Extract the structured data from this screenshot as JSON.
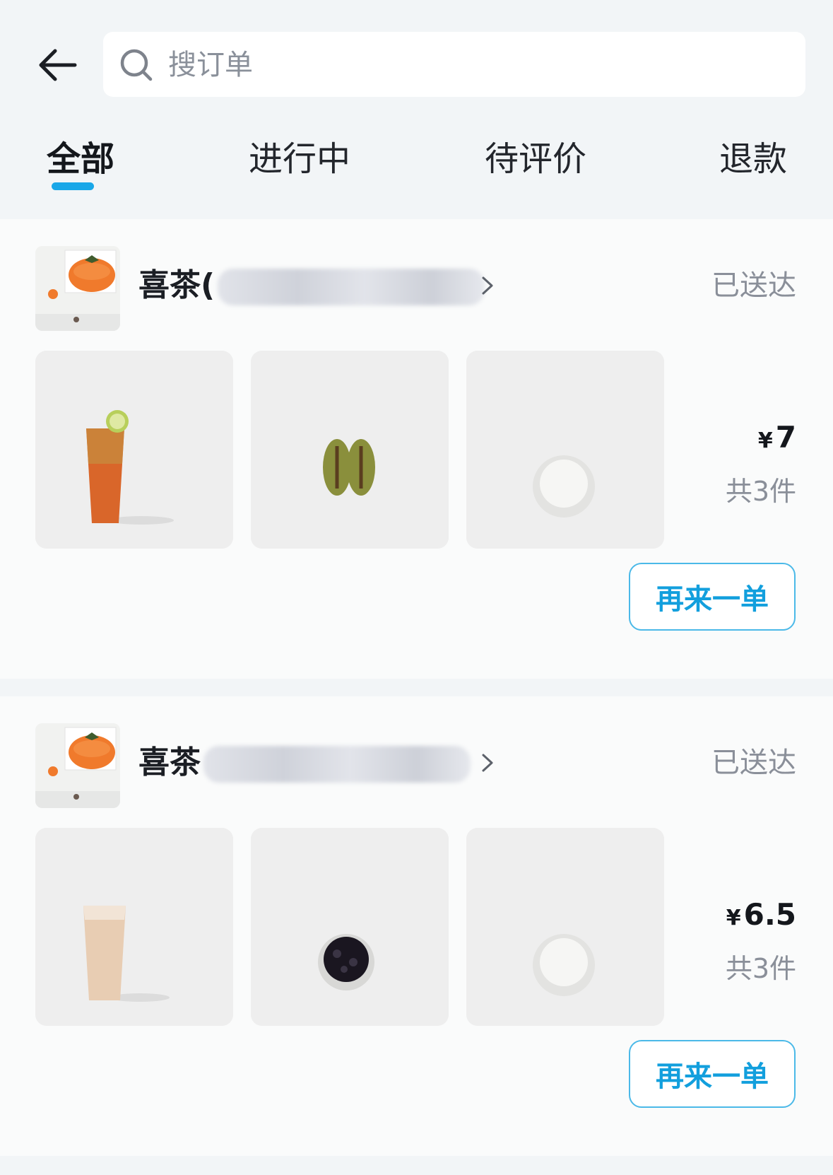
{
  "search": {
    "placeholder": "搜订单"
  },
  "tabs": [
    {
      "label": "全部",
      "active": true
    },
    {
      "label": "进行中",
      "active": false
    },
    {
      "label": "待评价",
      "active": false
    },
    {
      "label": "退款",
      "active": false
    }
  ],
  "orders": [
    {
      "store_name": "喜茶(",
      "status": "已送达",
      "currency": "¥",
      "price": "7",
      "count": "共3件",
      "reorder_label": "再来一单",
      "items": [
        "fruit-tea-drink-image",
        "pastry-image",
        "pudding-cup-image"
      ]
    },
    {
      "store_name": "喜茶",
      "status": "已送达",
      "currency": "¥",
      "price": "6.5",
      "count": "共3件",
      "reorder_label": "再来一单",
      "items": [
        "milk-tea-drink-image",
        "boba-pearls-cup-image",
        "pudding-cup-image"
      ]
    }
  ],
  "colors": {
    "accent": "#19a7e8",
    "button_text": "#129fdd",
    "muted": "#8a8f99",
    "background": "#f2f5f7"
  }
}
